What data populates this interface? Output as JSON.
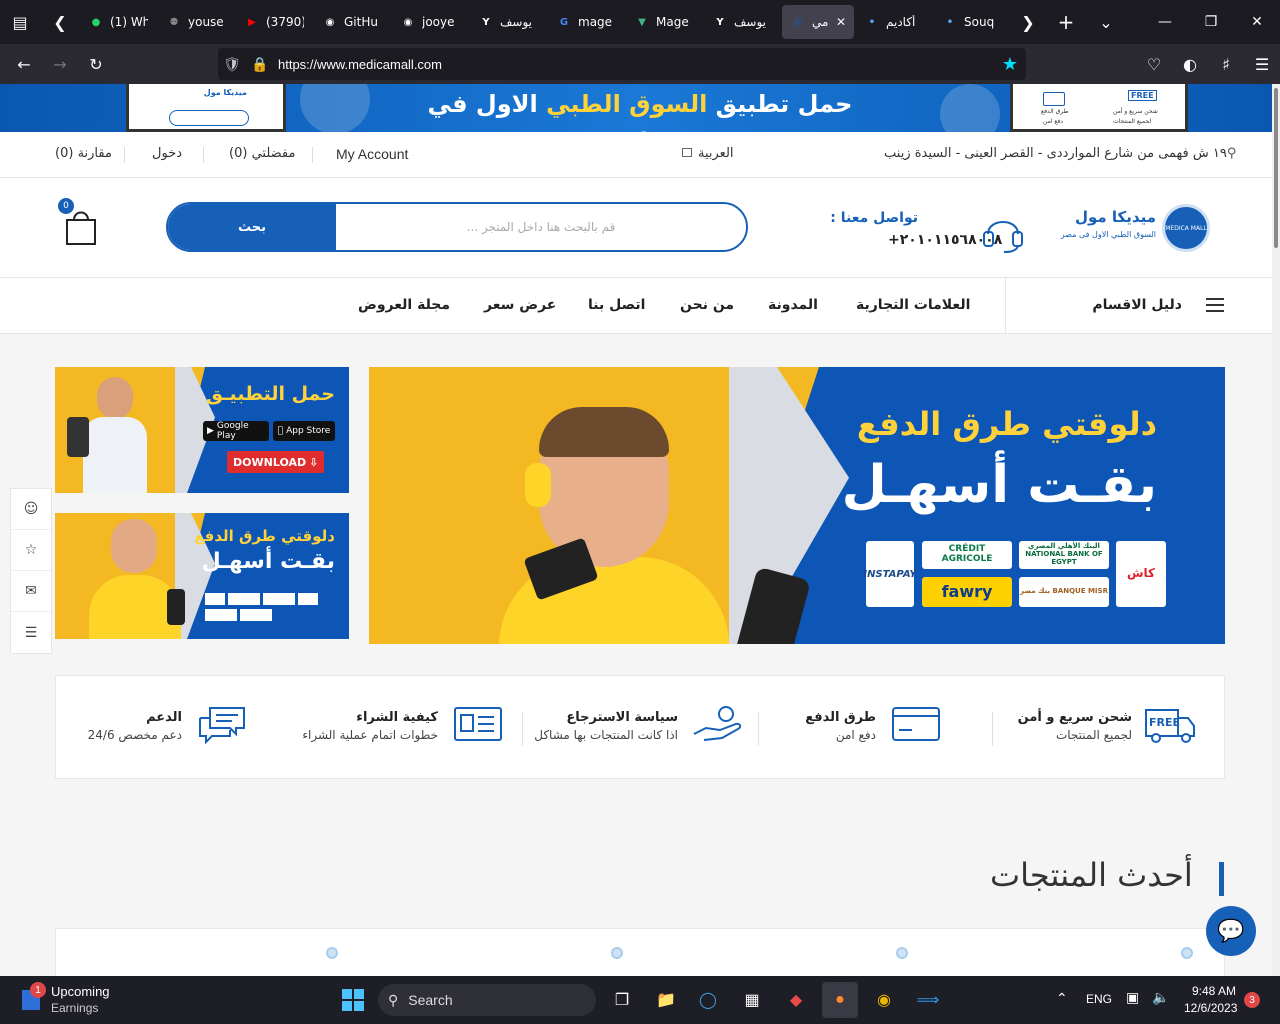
{
  "browser": {
    "tabs": [
      {
        "title": "(1) Wh",
        "favicon": "whatsapp-icon",
        "color": "#25d366"
      },
      {
        "title": "youse",
        "favicon": "person-icon",
        "color": "#888888"
      },
      {
        "title": "(3790)",
        "favicon": "youtube-icon",
        "color": "#ff0000"
      },
      {
        "title": "GitHu",
        "favicon": "github-icon",
        "color": "#ffffff"
      },
      {
        "title": "jooye",
        "favicon": "github-icon",
        "color": "#ffffff"
      },
      {
        "title": "يوسف",
        "favicon": "yandex-icon",
        "color": "#ffffff"
      },
      {
        "title": "mage",
        "favicon": "google-icon",
        "color": "#4285f4"
      },
      {
        "title": "Mage",
        "favicon": "vue-icon",
        "color": "#41b883"
      },
      {
        "title": "يوسف",
        "favicon": "yandex-icon",
        "color": "#ffffff"
      },
      {
        "title": "مي",
        "favicon": "medicamall-icon",
        "color": "#1760b8",
        "active": true
      },
      {
        "title": "أكاديم",
        "favicon": "dot-icon",
        "color": "#5aa7ff"
      },
      {
        "title": "Souq",
        "favicon": "dot-icon",
        "color": "#5aa7ff"
      }
    ],
    "url": "https://www.medicamall.com"
  },
  "promo": {
    "part1": "حمل تطبيق ",
    "highlight": "السوق الطبي",
    "part2": " الاول في مصر",
    "phone_left": "ميديكا مول",
    "phone_right_1": "شحن سريع و أمن",
    "phone_right_2": "لجميع المنتجات",
    "phone_right_3": "طرق الدفع",
    "phone_right_4": "دفع امن",
    "free": "FREE"
  },
  "topinfo": {
    "compare": "مقارنة (0)",
    "login": "دخول",
    "wishlist": "مفضلتي (0)",
    "account": "My Account",
    "language": "العربية",
    "address": "١٩ ش فهمى من شارع الموارددى - القصر العينى - السيدة زينب"
  },
  "header": {
    "cart_count": "0",
    "search_button": "بحث",
    "search_placeholder": "قم بالبحث هنا داخل المتجر ...",
    "contact_label": "تواصل معنا :",
    "contact_phone": "+٢٠١٠١١٥٦٨٠٠٨",
    "logo_title": "ميديكا مول",
    "logo_subtitle": "السوق الطبي الاول فى مصر",
    "logo_seal": "MEDICA MALL"
  },
  "menu": {
    "categories": "دليل الاقسام",
    "items": [
      "العلامات التجارية",
      "المدونة",
      "من نحن",
      "اتصل بنا",
      "عرض سعر",
      "مجلة العروض"
    ]
  },
  "hero": {
    "line1": "دلوقتي طرق الدفع",
    "line2": "بقـت أسهـل",
    "logos": [
      "INSTAPAY",
      "CRÉDIT AGRICOLE",
      "البنك الأهلي المصري NATIONAL BANK OF EGYPT",
      "كاش",
      "fawry",
      "بنك مصر BANQUE MISR"
    ]
  },
  "side_banner_1": {
    "title": "حمل التطبيـق",
    "google_play": "Google Play",
    "app_store": "App Store",
    "download": "DOWNLOAD"
  },
  "side_banner_2": {
    "line1": "دلوقتي طرق الدفع",
    "line2": "بقـت أسهـل"
  },
  "features": [
    {
      "title": "شحن سريع و أمن",
      "subtitle": "لجميع المنتجات",
      "icon": "free-truck-icon"
    },
    {
      "title": "طرق الدفع",
      "subtitle": "دفع امن",
      "icon": "credit-card-icon"
    },
    {
      "title": "سياسة الاسترجاع",
      "subtitle": "اذا كانت المنتجات بها مشاكل",
      "icon": "hand-return-icon"
    },
    {
      "title": "كيفية الشراء",
      "subtitle": "خطوات اتمام عملية الشراء",
      "icon": "id-card-icon"
    },
    {
      "title": "الدعم",
      "subtitle": "دعم مخصص 24/6",
      "icon": "chat-icon"
    }
  ],
  "section_title": "أحدث المنتجات",
  "taskbar": {
    "weather_title": "Upcoming",
    "weather_sub": "Earnings",
    "weather_badge": "1",
    "search": "Search",
    "lang": "ENG",
    "time": "9:48 AM",
    "date": "12/6/2023",
    "notif_count": "3"
  },
  "colors": {
    "brand_blue": "#1760b8",
    "accent_yellow": "#f4b823"
  }
}
